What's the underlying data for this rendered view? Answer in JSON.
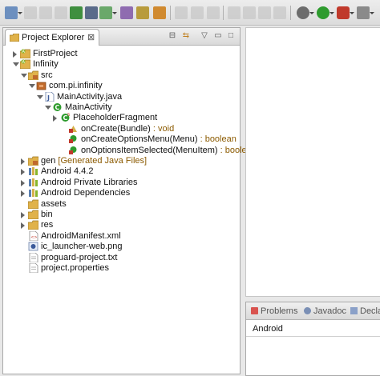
{
  "explorer": {
    "tab_label": "Project Explorer",
    "close_glyph": "⊠",
    "collapse_glyph": "⊟",
    "link_glyph": "⇆",
    "menu_glyph": "▽",
    "minimize_glyph": "▭",
    "maximize_glyph": "□",
    "tree": [
      {
        "label": "FirstProject",
        "icon": "android-project-icon",
        "arrow": "right"
      },
      {
        "label": "Infinity",
        "icon": "android-project-icon",
        "arrow": "down"
      },
      {
        "label": "src",
        "icon": "source-folder-icon",
        "arrow": "down"
      },
      {
        "label": "com.pi.infinity",
        "icon": "package-icon",
        "arrow": "down"
      },
      {
        "label": "MainActivity.java",
        "icon": "java-file-icon",
        "arrow": "down"
      },
      {
        "label": "MainActivity",
        "icon": "class-icon",
        "arrow": "down"
      },
      {
        "label": "PlaceholderFragment",
        "icon": "inner-class-icon",
        "arrow": "right"
      },
      {
        "label": "onCreate(Bundle)",
        "decoration": " : void",
        "icon": "protected-method-icon",
        "arrow": ""
      },
      {
        "label": "onCreateOptionsMenu(Menu)",
        "decoration": " : boolean",
        "icon": "public-method-icon",
        "arrow": ""
      },
      {
        "label": "onOptionsItemSelected(MenuItem)",
        "decoration": " : boolean",
        "icon": "public-method-icon",
        "arrow": ""
      },
      {
        "label": "gen",
        "decoration": " [Generated Java Files]",
        "icon": "source-folder-icon",
        "arrow": "right"
      },
      {
        "label": "Android 4.4.2",
        "icon": "library-icon",
        "arrow": "right"
      },
      {
        "label": "Android Private Libraries",
        "icon": "library-icon",
        "arrow": "right"
      },
      {
        "label": "Android Dependencies",
        "icon": "library-icon",
        "arrow": "right"
      },
      {
        "label": "assets",
        "icon": "folder-icon",
        "arrow": ""
      },
      {
        "label": "bin",
        "icon": "folder-icon",
        "arrow": "right"
      },
      {
        "label": "res",
        "icon": "folder-icon",
        "arrow": "right"
      },
      {
        "label": "AndroidManifest.xml",
        "icon": "xml-file-icon",
        "arrow": ""
      },
      {
        "label": "ic_launcher-web.png",
        "icon": "image-file-icon",
        "arrow": ""
      },
      {
        "label": "proguard-project.txt",
        "icon": "text-file-icon",
        "arrow": ""
      },
      {
        "label": "project.properties",
        "icon": "text-file-icon",
        "arrow": ""
      }
    ]
  },
  "bottom_panel": {
    "tabs": [
      {
        "label": "Problems",
        "icon": "problems-icon"
      },
      {
        "label": "Javadoc",
        "icon": "javadoc-icon"
      },
      {
        "label": "Decla",
        "icon": "declaration-icon"
      }
    ],
    "title": "Android"
  },
  "colors": {
    "decoration": "#8b5a00",
    "folder": "#e0b24a",
    "android": "#8ab62b",
    "method_green": "#2e9b2e",
    "method_red": "#c0392b",
    "package": "#c06a2b"
  }
}
